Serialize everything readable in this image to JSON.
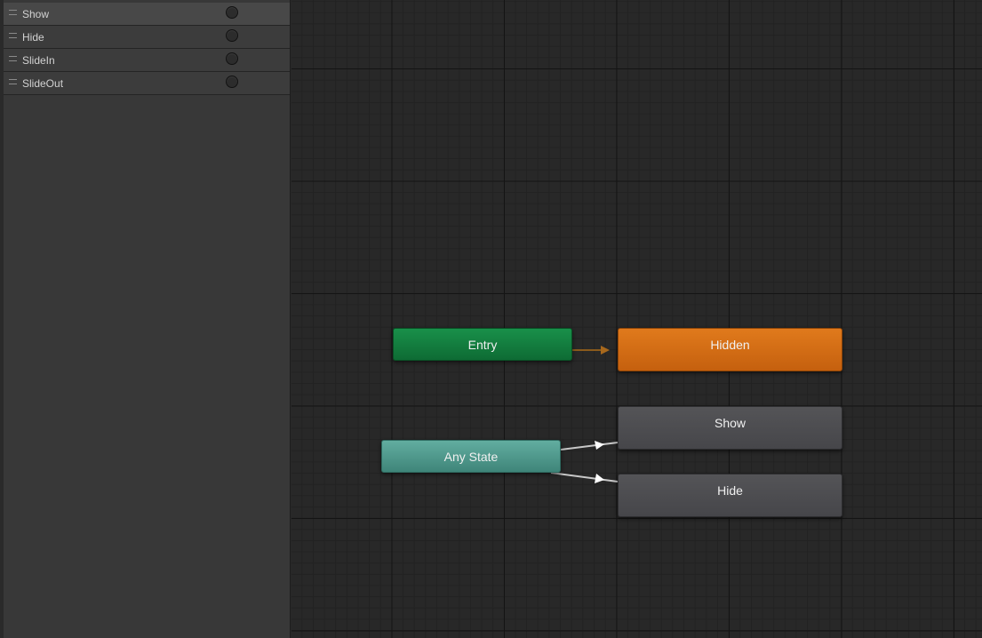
{
  "parameters": [
    {
      "name": "Show",
      "icon": "trigger-icon"
    },
    {
      "name": "Hide",
      "icon": "trigger-icon"
    },
    {
      "name": "SlideIn",
      "icon": "trigger-icon"
    },
    {
      "name": "SlideOut",
      "icon": "trigger-icon"
    }
  ],
  "states": {
    "entry": "Entry",
    "any_state": "Any State",
    "hidden": "Hidden",
    "show": "Show",
    "hide": "Hide"
  },
  "colors": {
    "entry": "#148040",
    "any_state": "#509a8d",
    "default_state": "#d26d15",
    "state": "#4d4d50",
    "entry_transition": "#8a5a1c",
    "transition": "#c8c8c8"
  }
}
